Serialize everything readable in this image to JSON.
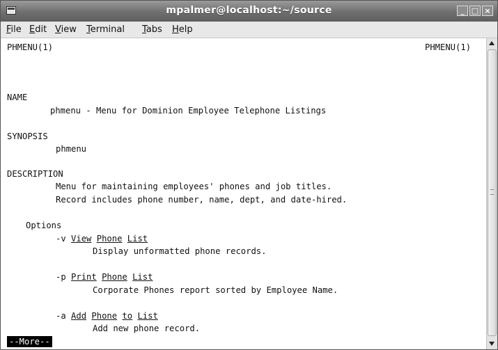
{
  "window": {
    "title": "mpalmer@localhost:~/source",
    "controls": {
      "minimize": "_",
      "maximize": "□",
      "close": "×"
    }
  },
  "menu": {
    "items": [
      "File",
      "Edit",
      "View",
      "Terminal",
      "Tabs",
      "Help"
    ]
  },
  "man": {
    "header_left": "PHMENU(1)",
    "header_right": "PHMENU(1)",
    "name_heading": "NAME",
    "name_text": "phmenu - Menu for Dominion Employee Telephone Listings",
    "synopsis_heading": "SYNOPSIS",
    "synopsis_text": "phmenu",
    "description_heading": "DESCRIPTION",
    "description_line1": "Menu for maintaining employees' phones and job titles.",
    "description_line2": "Record includes phone number, name, dept, and date-hired.",
    "options_heading": "Options",
    "options": [
      {
        "flag": "-v",
        "words": [
          "View",
          "Phone",
          "List"
        ],
        "desc": "Display unformatted phone records."
      },
      {
        "flag": "-p",
        "words": [
          "Print",
          "Phone",
          "List"
        ],
        "desc": "Corporate Phones report sorted by Employee Name."
      },
      {
        "flag": "-a",
        "words": [
          "Add",
          "Phone",
          "to",
          "List"
        ],
        "desc": "Add new phone record."
      }
    ]
  },
  "pager": {
    "prompt": "--More--"
  },
  "icons": {
    "window": "terminal-window-icon",
    "scroll_up": "scroll-up-arrow-icon",
    "scroll_down": "scroll-down-arrow-icon"
  }
}
